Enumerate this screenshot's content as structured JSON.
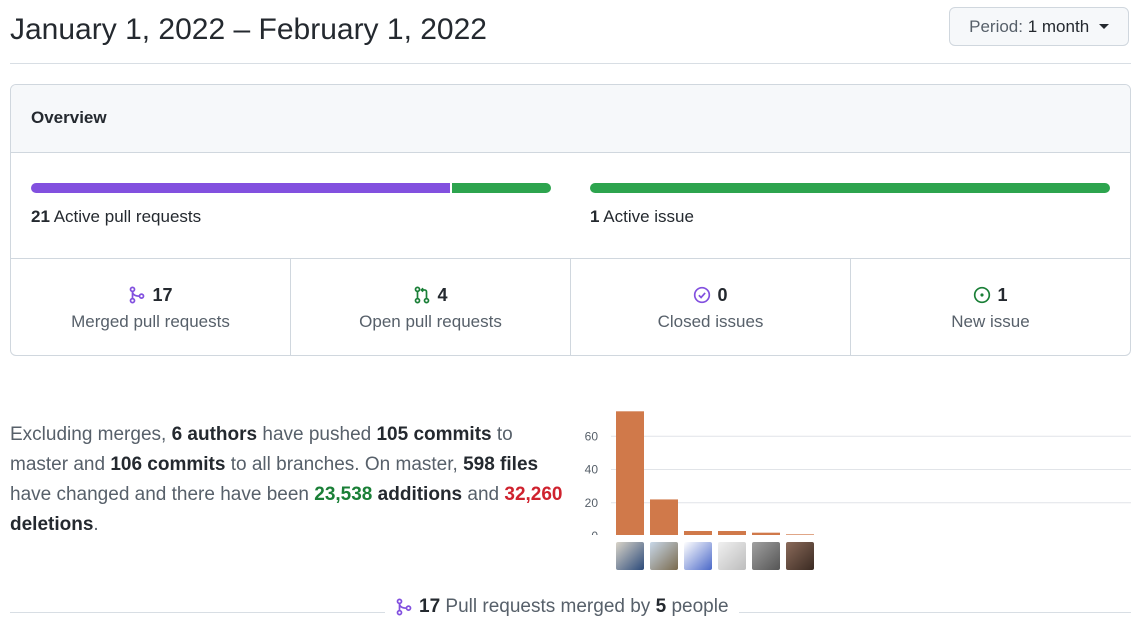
{
  "header": {
    "date_range": "January 1, 2022 – February 1, 2022",
    "period_label": "Period:",
    "period_value": "1 month"
  },
  "overview": {
    "title": "Overview",
    "active_prs": {
      "count": "21",
      "label": "Active pull requests",
      "merged_fraction": 0.81
    },
    "active_issues": {
      "count": "1",
      "label": "Active issue",
      "fraction": 1.0
    },
    "stats": [
      {
        "value": "17",
        "label": "Merged pull requests",
        "icon": "git-merge-icon",
        "color": "#8250df"
      },
      {
        "value": "4",
        "label": "Open pull requests",
        "icon": "git-pull-request-icon",
        "color": "#1a7f37"
      },
      {
        "value": "0",
        "label": "Closed issues",
        "icon": "issue-closed-icon",
        "color": "#8250df"
      },
      {
        "value": "1",
        "label": "New issue",
        "icon": "issue-opened-icon",
        "color": "#1a7f37"
      }
    ]
  },
  "summary": {
    "t1": "Excluding merges, ",
    "authors": "6 authors",
    "t2": " have pushed ",
    "commits_master": "105 commits",
    "t3": " to master and ",
    "commits_all": "106 commits",
    "t4": " to all branches. On master, ",
    "files": "598 files",
    "t5": " have changed and there have been ",
    "additions_num": "23,538",
    "additions_word": " additions",
    "t6": " and ",
    "deletions_num": "32,260",
    "deletions_word": " deletions",
    "t7": "."
  },
  "chart_data": {
    "type": "bar",
    "categories": [
      "contributor-1",
      "contributor-2",
      "contributor-3",
      "contributor-4",
      "contributor-5",
      "contributor-6"
    ],
    "values": [
      75,
      22,
      3,
      3,
      2,
      1
    ],
    "yticks": [
      0,
      20,
      40,
      60
    ],
    "ylim": [
      0,
      80
    ],
    "bar_color": "#d0794a",
    "grid": true,
    "x_tick_labels": "avatars"
  },
  "footer": {
    "count": "17",
    "t1": " Pull requests merged by ",
    "people": "5",
    "t2": " people"
  },
  "colors": {
    "purple": "#8250df",
    "green": "#2da44e",
    "addition_green": "#1a7f37",
    "deletion_red": "#cf222e",
    "bar": "#d0794a"
  }
}
